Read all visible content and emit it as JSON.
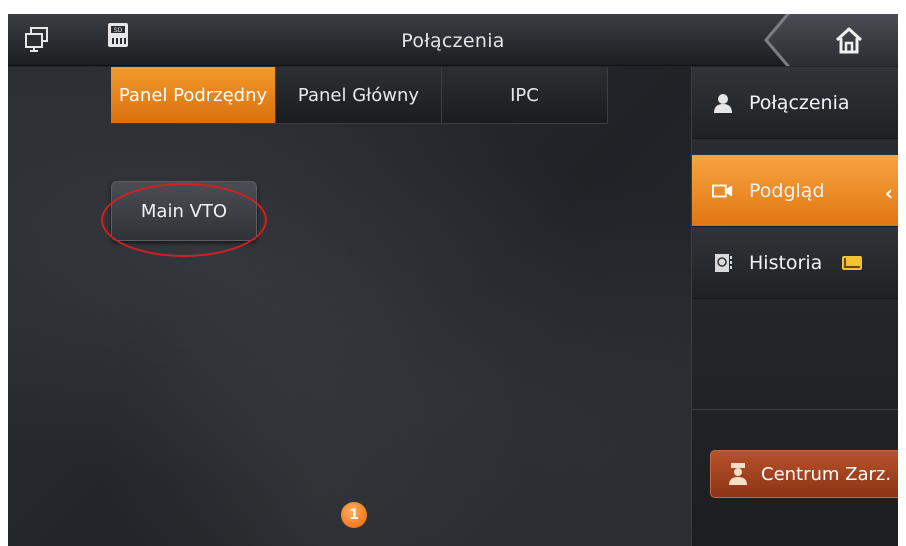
{
  "topbar": {
    "title": "Połączenia",
    "icons": [
      "monitor-icon",
      "sd-card-icon",
      "home-icon"
    ],
    "sd_label": "SD"
  },
  "tabs": [
    {
      "label": "Panel Podrzędny",
      "active": true
    },
    {
      "label": "Panel Główny",
      "active": false
    },
    {
      "label": "IPC",
      "active": false
    }
  ],
  "devices": [
    {
      "label": "Main VTO"
    }
  ],
  "pagination": {
    "current": "1"
  },
  "sidebar": {
    "items": [
      {
        "label": "Połączenia",
        "icon": "person-icon",
        "active": false
      },
      {
        "label": "Podgląd",
        "icon": "camera-icon",
        "active": true
      },
      {
        "label": "Historia",
        "icon": "contacts-icon",
        "active": false,
        "badge": "mail-icon"
      }
    ],
    "active_arrow": "‹",
    "admin_button": "Centrum Zarz."
  },
  "colors": {
    "accent": "#ee8a1e",
    "admin_button": "#a4441f",
    "highlight": "#d61f1f"
  }
}
